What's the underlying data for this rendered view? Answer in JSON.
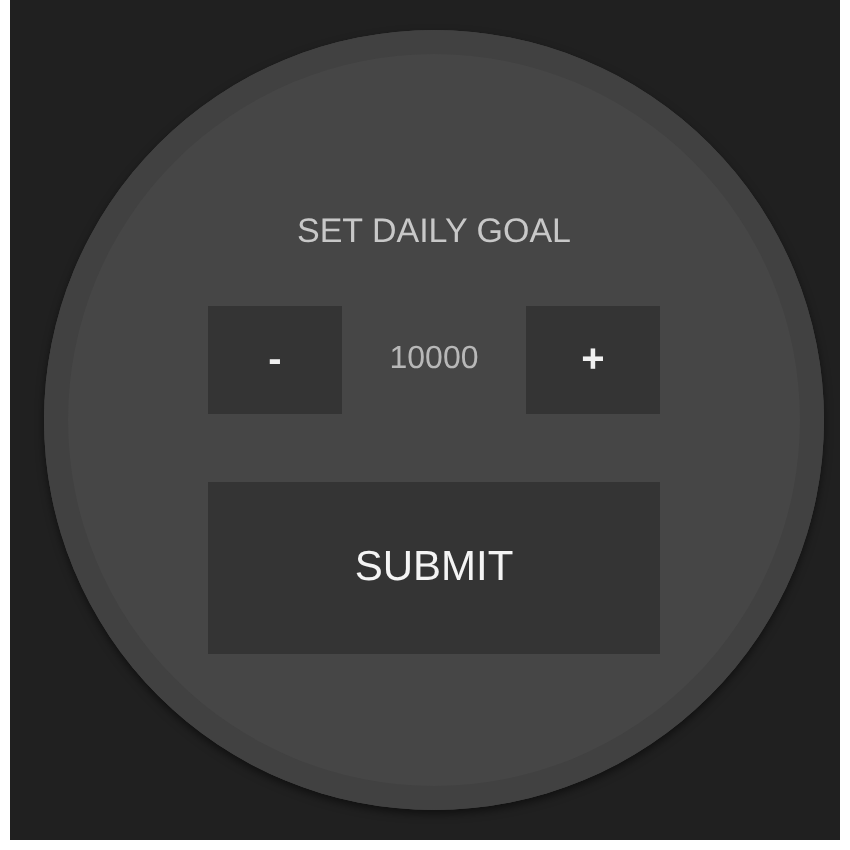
{
  "title": "SET DAILY GOAL",
  "stepper": {
    "decrement": "-",
    "value": "10000",
    "increment": "+"
  },
  "submit": "SUBMIT"
}
